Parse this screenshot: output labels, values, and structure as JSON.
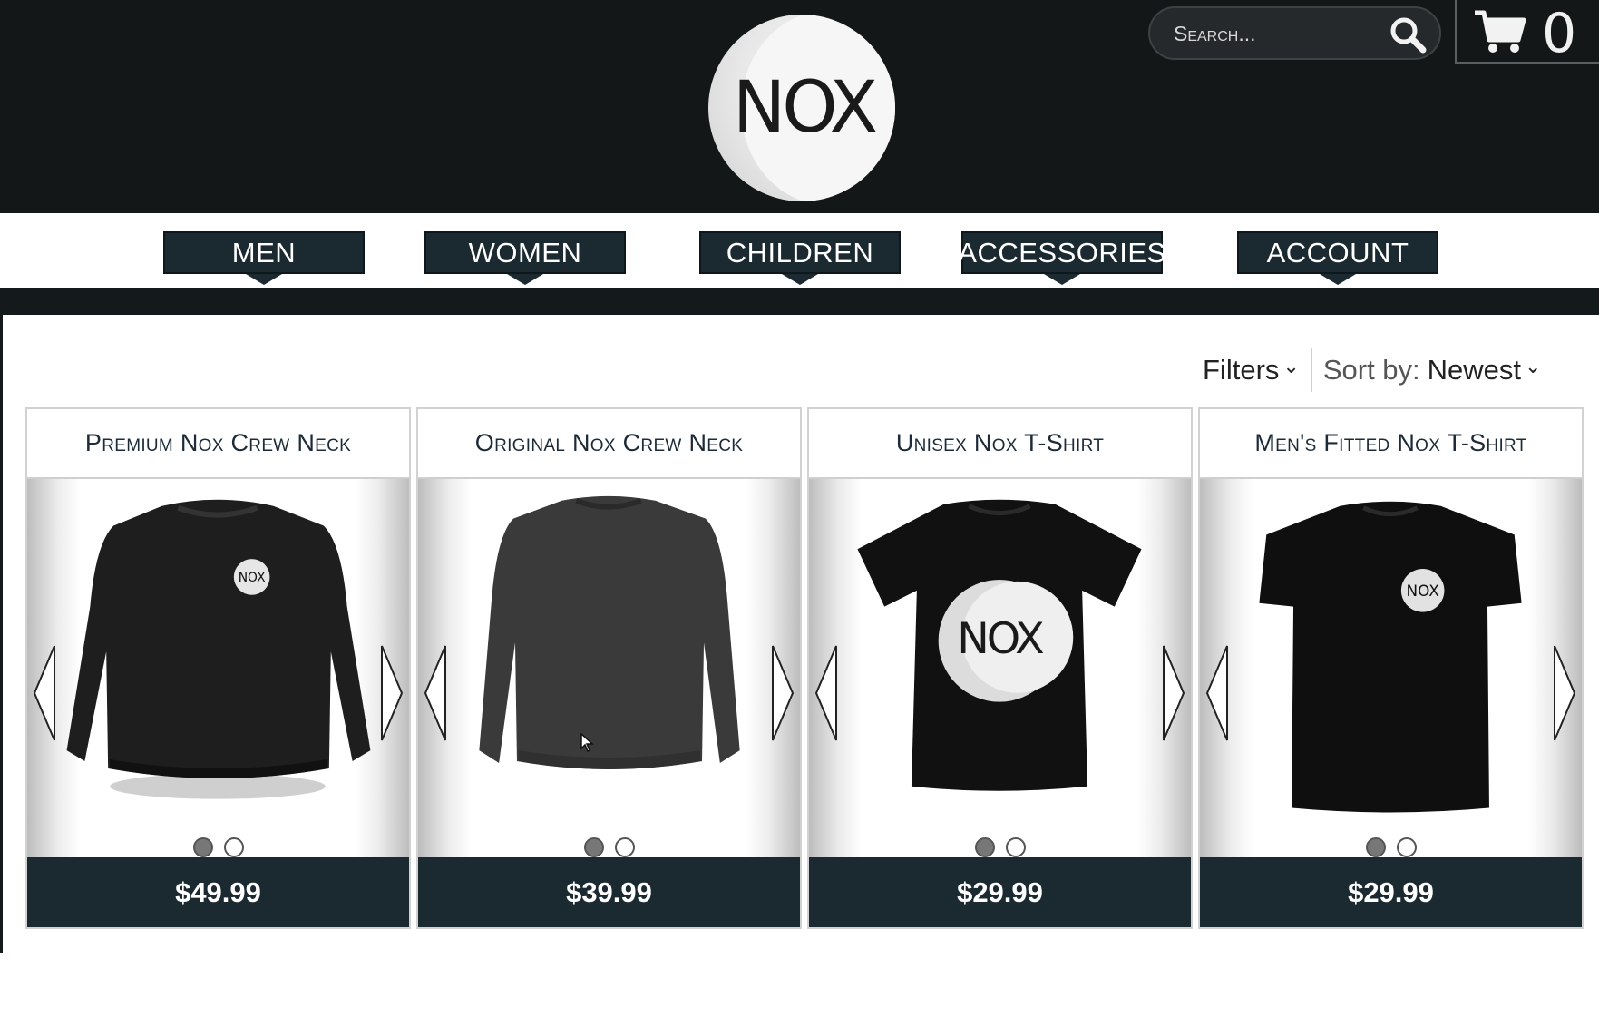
{
  "brand": {
    "logo_text": "NOX"
  },
  "search": {
    "placeholder": "Search..."
  },
  "cart": {
    "count": "0"
  },
  "nav": {
    "items": [
      {
        "label": "MEN"
      },
      {
        "label": "WOMEN"
      },
      {
        "label": "CHILDREN"
      },
      {
        "label": "ACCESSORIES"
      },
      {
        "label": "ACCOUNT"
      }
    ]
  },
  "toolbar": {
    "filters_label": "Filters",
    "sort_prefix": "Sort by:",
    "sort_value": "Newest"
  },
  "products": [
    {
      "title": "Premium Nox Crew Neck",
      "price": "$49.99",
      "image_badge": "NOX",
      "image_count": 2,
      "active_image": 1
    },
    {
      "title": "Original Nox Crew Neck",
      "price": "$39.99",
      "image_badge": "",
      "image_count": 2,
      "active_image": 1
    },
    {
      "title": "Unisex Nox T-Shirt",
      "price": "$29.99",
      "image_badge": "NOX",
      "image_count": 2,
      "active_image": 1
    },
    {
      "title": "Men's Fitted Nox T-Shirt",
      "price": "$29.99",
      "image_badge": "NOX",
      "image_count": 2,
      "active_image": 1
    }
  ],
  "colors": {
    "header_bg": "#131718",
    "nav_button": "#1b2931",
    "price_bar": "#1b2931",
    "title_text": "#1d2b38"
  }
}
